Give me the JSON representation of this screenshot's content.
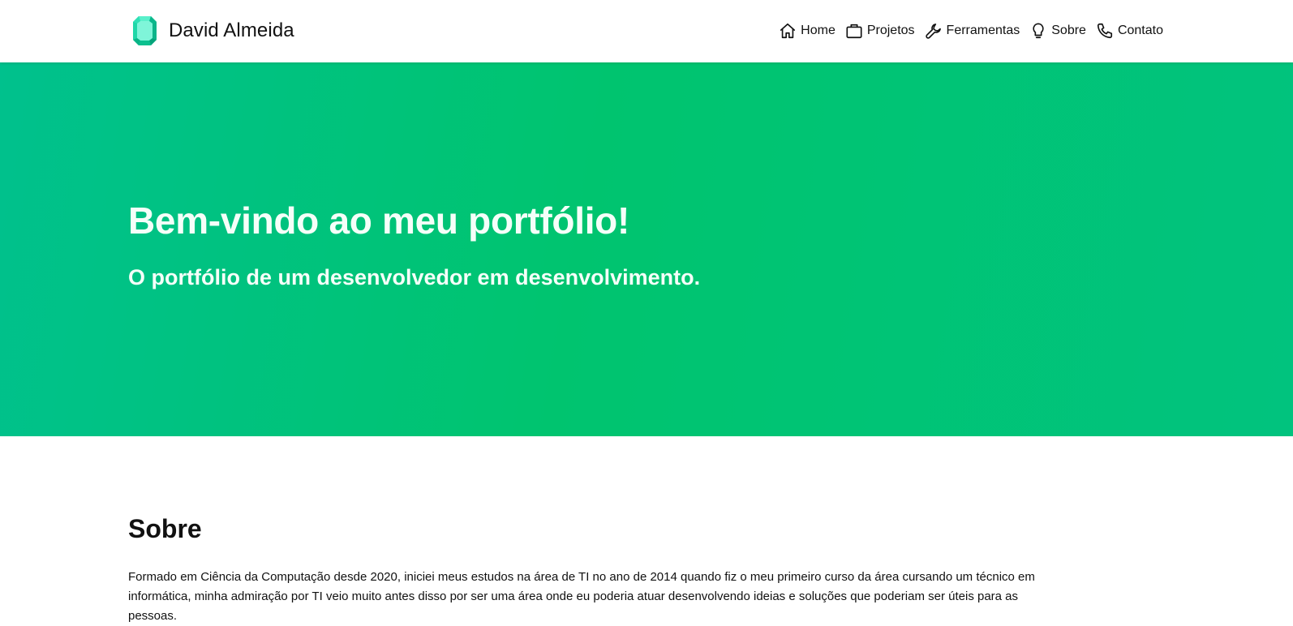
{
  "brand": {
    "name": "David Almeida",
    "logo_icon": "emerald-gem-icon",
    "logo_colors": [
      "#2ee6b8",
      "#0fc79a",
      "#7ff5d9"
    ]
  },
  "nav": {
    "items": [
      {
        "label": "Home",
        "icon": "home-icon"
      },
      {
        "label": "Projetos",
        "icon": "briefcase-icon"
      },
      {
        "label": "Ferramentas",
        "icon": "wrench-icon"
      },
      {
        "label": "Sobre",
        "icon": "lightbulb-icon"
      },
      {
        "label": "Contato",
        "icon": "phone-icon"
      }
    ]
  },
  "hero": {
    "title": "Bem-vindo ao meu portfólio!",
    "subtitle": "O portfólio de um desenvolvedor em desenvolvimento.",
    "background_colors": [
      "#00c18d",
      "#00c46f"
    ]
  },
  "about": {
    "title": "Sobre",
    "text": "Formado em Ciência da Computação desde 2020, iniciei meus estudos na área de TI no ano de 2014 quando fiz o meu primeiro curso da área cursando um técnico em informática, minha admiração por TI veio muito antes disso por ser uma área onde eu poderia atuar desenvolvendo ideias e soluções que poderiam ser úteis para as pessoas."
  }
}
